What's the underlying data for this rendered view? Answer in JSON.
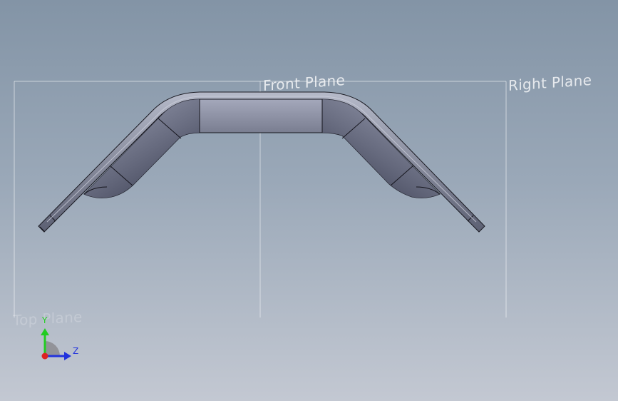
{
  "viewport": {
    "background_top": "#8394a6",
    "background_bottom": "#c3c8d2"
  },
  "planes": {
    "front": {
      "label": "Front Plane"
    },
    "right": {
      "label": "Right Plane"
    },
    "top": {
      "label": "Top Plane"
    }
  },
  "part": {
    "body_color": "#5b5e70",
    "highlight_color": "#9ea3b7",
    "edge_color": "#1a1a22"
  },
  "triad": {
    "y_label": "Y",
    "z_label": "Z",
    "y_color": "#22cc22",
    "z_color": "#2233dd",
    "x_color": "#dd2222"
  }
}
